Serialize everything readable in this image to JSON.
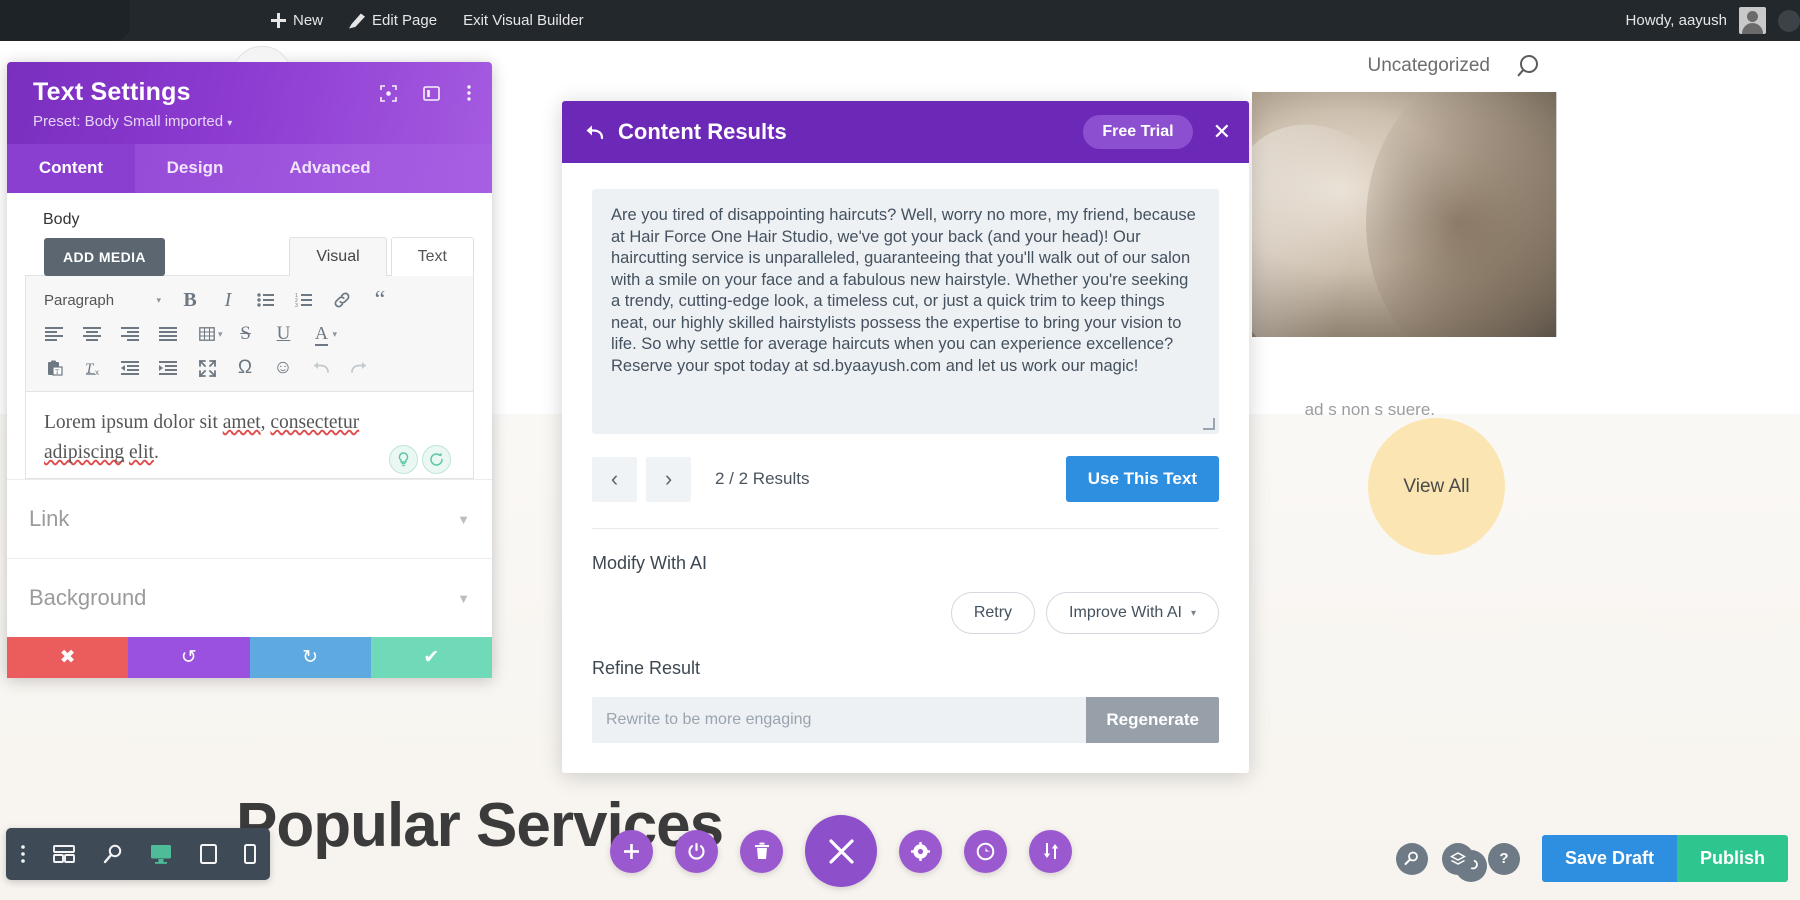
{
  "admin_bar": {
    "items": [
      {
        "label": "New",
        "icon": "plus-icon"
      },
      {
        "label": "Edit Page",
        "icon": "pencil-icon"
      },
      {
        "label": "Exit Visual Builder",
        "icon": ""
      }
    ],
    "howdy": "Howdy, aayush"
  },
  "site": {
    "category": "Uncategorized",
    "search_icon": "search-icon",
    "ghost_text": "ad  s non s suere.",
    "view_all": "View All",
    "heading": "Popular Services"
  },
  "text_settings": {
    "title": "Text Settings",
    "preset": "Preset: Body Small imported",
    "preset_caret": "▾",
    "header_icons": [
      "focus-icon",
      "layout-icon",
      "more-vertical-icon"
    ],
    "tabs": [
      {
        "label": "Content",
        "active": true
      },
      {
        "label": "Design",
        "active": false
      },
      {
        "label": "Advanced",
        "active": false
      }
    ],
    "body_label": "Body",
    "add_media": "ADD MEDIA",
    "editor_tabs": [
      {
        "label": "Visual",
        "active": true
      },
      {
        "label": "Text",
        "active": false
      }
    ],
    "toolbar_row1": [
      {
        "name": "paragraph-format-select",
        "label": "Paragraph"
      },
      {
        "name": "bold-icon",
        "label": "B"
      },
      {
        "name": "italic-icon",
        "label": "I"
      },
      {
        "name": "bullet-list-icon",
        "label": ""
      },
      {
        "name": "numbered-list-icon",
        "label": ""
      },
      {
        "name": "link-icon",
        "label": ""
      },
      {
        "name": "blockquote-icon",
        "label": "“"
      }
    ],
    "toolbar_row2": [
      {
        "name": "align-left-icon"
      },
      {
        "name": "align-center-icon"
      },
      {
        "name": "align-right-icon"
      },
      {
        "name": "align-justify-icon"
      },
      {
        "name": "table-icon"
      },
      {
        "name": "strikethrough-icon",
        "label": "S"
      },
      {
        "name": "underline-icon",
        "label": "U"
      },
      {
        "name": "text-color-icon",
        "label": "A"
      }
    ],
    "toolbar_row3": [
      {
        "name": "paste-as-text-icon"
      },
      {
        "name": "clear-formatting-icon"
      },
      {
        "name": "outdent-icon"
      },
      {
        "name": "indent-icon"
      },
      {
        "name": "fullscreen-icon"
      },
      {
        "name": "special-character-icon",
        "label": "Ω"
      },
      {
        "name": "emoji-icon",
        "label": "☺"
      },
      {
        "name": "undo-icon"
      },
      {
        "name": "redo-icon"
      }
    ],
    "content_line1_a": "Lorem ipsum dolor sit ",
    "content_line1_b": "amet",
    "content_line1_c": ", ",
    "content_line1_d": "consectetur",
    "content_line2_a": "adipiscing",
    "content_line2_b": " ",
    "content_line2_c": "elit",
    "content_line2_d": ".",
    "ai_buttons": [
      "ai-generate-icon",
      "ai-refresh-icon"
    ],
    "sections": [
      {
        "label": "Link"
      },
      {
        "label": "Background"
      }
    ],
    "footer_buttons": [
      {
        "name": "cancel-button",
        "icon": "✖"
      },
      {
        "name": "undo-button",
        "icon": "↺"
      },
      {
        "name": "redo-button",
        "icon": "↻"
      },
      {
        "name": "save-button",
        "icon": "✔"
      }
    ]
  },
  "content_results": {
    "back_icon": "back-arrow-icon",
    "title": "Content Results",
    "free_trial": "Free Trial",
    "close": "✕",
    "result_text": "Are you tired of disappointing haircuts? Well, worry no more, my friend, because at Hair Force One Hair Studio, we've got your back (and your head)! Our haircutting service is unparalleled, guaranteeing that you'll walk out of our salon with a smile on your face and a fabulous new hairstyle. Whether you're seeking a trendy, cutting-edge look, a timeless cut, or just a quick trim to keep things neat, our highly skilled hairstylists possess the expertise to bring your vision to life. So why settle for average haircuts when you can experience excellence? Reserve your spot today at sd.byaayush.com and let us work our magic!",
    "prev_arrow": "‹",
    "next_arrow": "›",
    "results_count": "2 / 2 Results",
    "use_this_text": "Use This Text",
    "modify_heading": "Modify With AI",
    "retry": "Retry",
    "improve": "Improve With AI",
    "improve_caret": "▾",
    "refine_heading": "Refine Result",
    "refine_placeholder": "Rewrite to be more engaging",
    "refine_value": "",
    "regenerate": "Regenerate"
  },
  "device_bar": [
    {
      "name": "more-options-icon"
    },
    {
      "name": "wireframe-icon"
    },
    {
      "name": "zoom-out-icon"
    },
    {
      "name": "desktop-icon",
      "active": true
    },
    {
      "name": "tablet-icon"
    },
    {
      "name": "phone-icon"
    }
  ],
  "fab_bar": [
    {
      "name": "add-icon",
      "size": "sm",
      "glyph": "＋"
    },
    {
      "name": "power-icon",
      "size": "sm",
      "glyph": "⏻"
    },
    {
      "name": "trash-icon",
      "size": "sm",
      "glyph": "🗑"
    },
    {
      "name": "close-builder-icon",
      "size": "lg",
      "glyph": "✕"
    },
    {
      "name": "settings-gear-icon",
      "size": "sm",
      "glyph": "⚙"
    },
    {
      "name": "history-icon",
      "size": "sm",
      "glyph": "◔"
    },
    {
      "name": "sort-icon",
      "size": "sm",
      "glyph": "⇅"
    }
  ],
  "bottom_right": {
    "icons": [
      {
        "name": "zoom-icon",
        "glyph": "⌕"
      },
      {
        "name": "layers-icon",
        "glyph": "≣"
      },
      {
        "name": "help-icon",
        "glyph": "?"
      }
    ],
    "save_draft": "Save Draft",
    "publish": "Publish"
  },
  "colors": {
    "divi_purple": "#8b3fd0",
    "modal_purple": "#6c29b8",
    "accent_blue": "#2e8fe0",
    "publish_green": "#2ec58e",
    "admin_dark": "#23282d"
  }
}
